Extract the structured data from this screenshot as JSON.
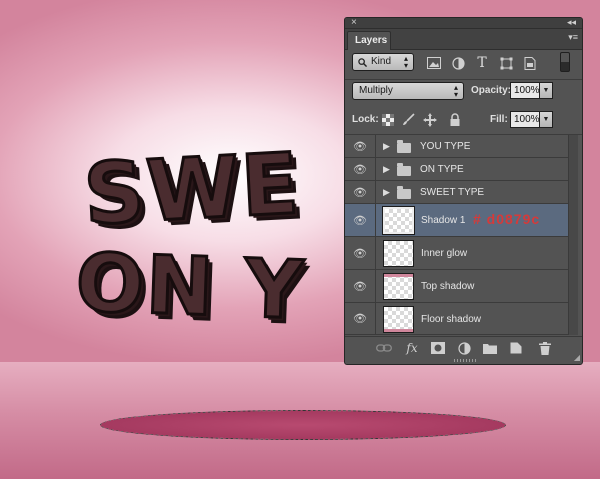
{
  "canvas": {
    "art_line_1": "SWE",
    "art_line_2": "ON Y",
    "colors": {
      "background": "#e3a3b7",
      "text_fill": "#4a2c2f",
      "floor_ellipse": "#a53a60"
    }
  },
  "panel": {
    "close_glyph": "×",
    "collapse_glyph": "◂◂",
    "tab_label": "Layers",
    "menu_glyph": "▾≡",
    "filter": {
      "kind_label": "Kind",
      "kind_icon": "search-icon",
      "icons": [
        "image-filter-icon",
        "adjustment-filter-icon",
        "type-filter-icon",
        "shape-filter-icon",
        "smart-object-filter-icon"
      ],
      "type_glyph": "T"
    },
    "blend": {
      "mode": "Multiply",
      "opacity_label": "Opacity:",
      "opacity_value": "100%"
    },
    "lock": {
      "label": "Lock:",
      "fill_label": "Fill:",
      "fill_value": "100%"
    },
    "layers": [
      {
        "name": "YOU TYPE",
        "kind": "group"
      },
      {
        "name": "ON TYPE",
        "kind": "group"
      },
      {
        "name": "SWEET TYPE",
        "kind": "group"
      },
      {
        "name": "Shadow 1",
        "kind": "layer",
        "selected": true,
        "annotation": "# d0879c"
      },
      {
        "name": "Inner glow",
        "kind": "layer"
      },
      {
        "name": "Top shadow",
        "kind": "layer"
      },
      {
        "name": "Floor shadow",
        "kind": "layer"
      }
    ],
    "bottom_icons": [
      "link-layers-icon",
      "fx-icon",
      "add-mask-icon",
      "adjustment-layer-icon",
      "new-group-icon",
      "new-layer-icon",
      "delete-layer-icon"
    ],
    "fx_label": "fx"
  }
}
